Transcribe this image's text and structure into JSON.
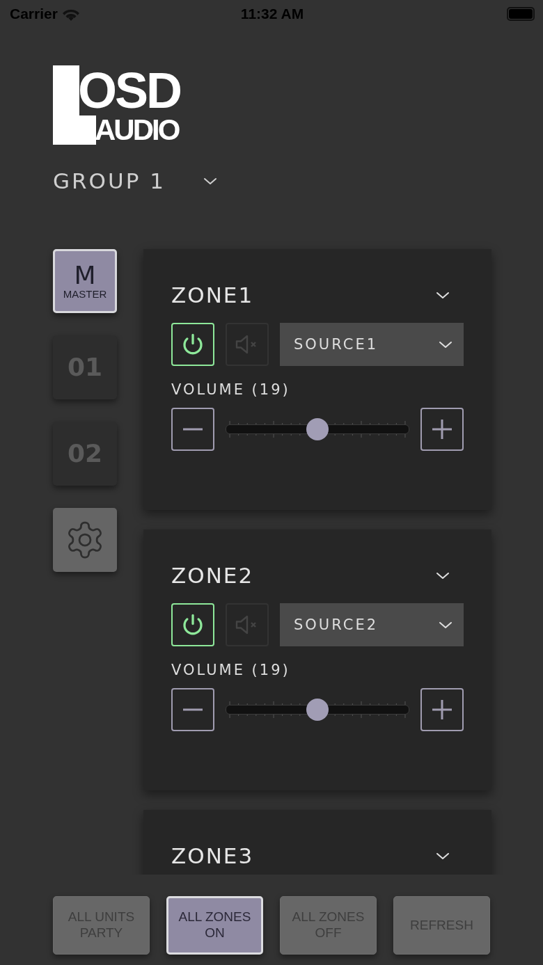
{
  "status_bar": {
    "carrier": "Carrier",
    "time": "11:32 AM"
  },
  "logo": {
    "top": "OSD",
    "bottom": "AUDIO"
  },
  "group": {
    "label": "GROUP 1"
  },
  "units": [
    {
      "kind": "master",
      "title": "M",
      "subtitle": "MASTER",
      "selected": true,
      "disabled": false
    },
    {
      "kind": "unit",
      "title": "01",
      "selected": false,
      "disabled": true
    },
    {
      "kind": "unit",
      "title": "02",
      "selected": false,
      "disabled": true
    },
    {
      "kind": "settings",
      "selected": false
    }
  ],
  "zones": [
    {
      "name": "ZONE1",
      "power_on": true,
      "muted": false,
      "source": "SOURCE1",
      "volume_label": "VOLUME (19)",
      "level": 0.5
    },
    {
      "name": "ZONE2",
      "power_on": true,
      "muted": false,
      "source": "SOURCE2",
      "volume_label": "VOLUME (19)",
      "level": 0.5
    },
    {
      "name": "ZONE3"
    }
  ],
  "actions": [
    {
      "label": "ALL UNITS\nPARTY",
      "selected": false
    },
    {
      "label": "ALL ZONES\nON",
      "selected": true
    },
    {
      "label": "ALL ZONES\nOFF",
      "selected": false
    },
    {
      "label": "REFRESH",
      "selected": false
    }
  ]
}
